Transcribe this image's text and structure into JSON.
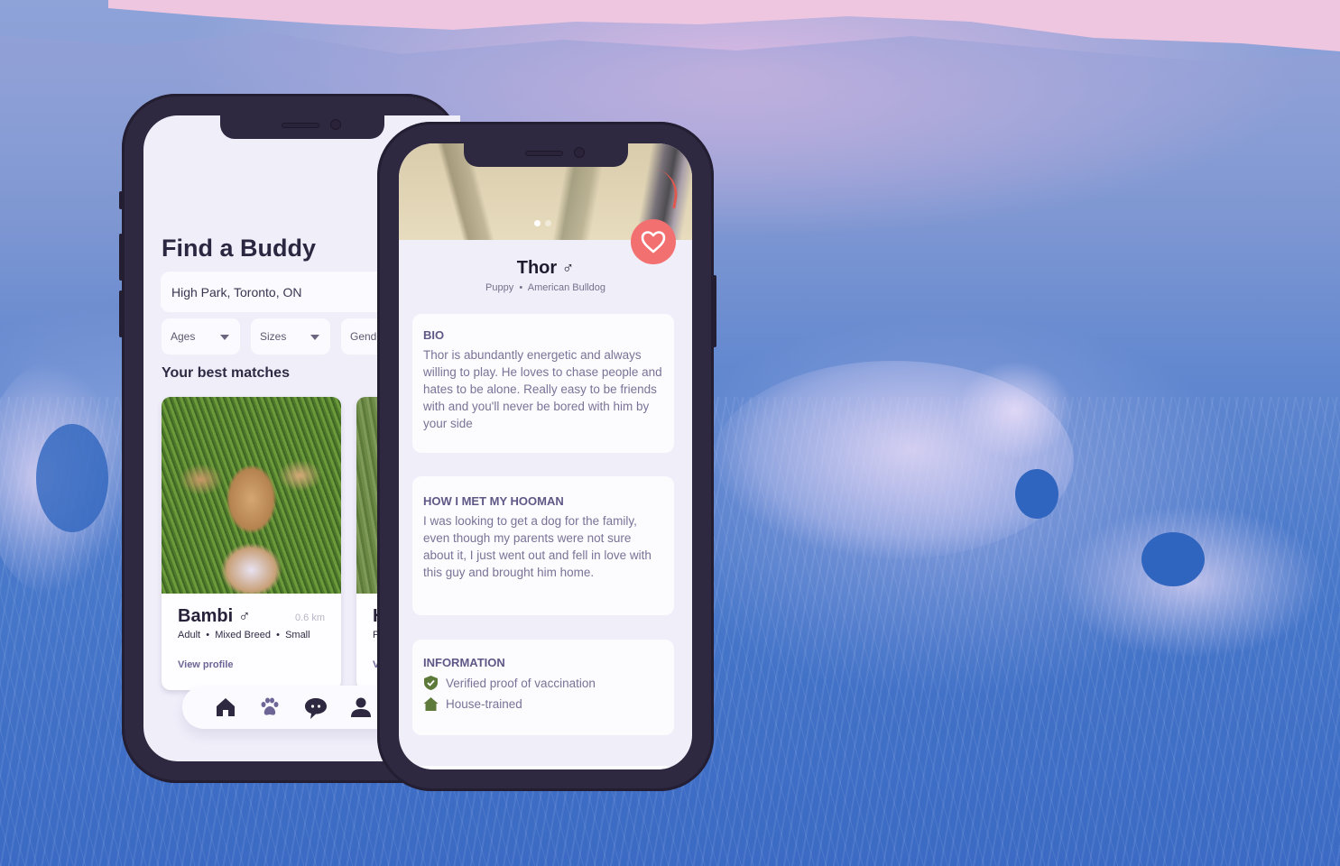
{
  "colors": {
    "phone_frame": "#2f2841",
    "screen_bg": "#f0eef9",
    "card_bg": "#fefdff",
    "accent_purple": "#6c6596",
    "favorite_red": "#f27070",
    "text_dark": "#27223a",
    "info_green": "#5d7a3a"
  },
  "find_buddy_screen": {
    "title": "Find a Buddy",
    "search": {
      "value": "High Park, Toronto, ON",
      "icon": "location-icon"
    },
    "filters": [
      {
        "label": "Ages",
        "icon": "caret-down-icon"
      },
      {
        "label": "Sizes",
        "icon": "caret-down-icon"
      },
      {
        "label": "Gender",
        "icon": "caret-down-icon"
      }
    ],
    "matches_heading": "Your best matches",
    "cards": [
      {
        "name": "Bambi",
        "gender_symbol": "♂",
        "distance": "0.6 km",
        "meta": [
          "Adult",
          "Mixed Breed",
          "Small"
        ],
        "separator": "•",
        "link": "View profile"
      },
      {
        "name": "H",
        "gender_symbol": "",
        "distance": "",
        "meta": [
          "P"
        ],
        "separator": "",
        "link": "V"
      }
    ],
    "bottom_nav": [
      {
        "name": "home",
        "icon": "home-icon",
        "active": false
      },
      {
        "name": "pets",
        "icon": "paw-icon",
        "active": true
      },
      {
        "name": "messages",
        "icon": "chat-icon",
        "active": false
      },
      {
        "name": "profile",
        "icon": "user-icon",
        "active": false
      }
    ]
  },
  "profile_screen": {
    "photo_count": 2,
    "active_photo": 1,
    "favorite_icon": "heart-icon",
    "name": "Thor",
    "gender_symbol": "♂",
    "age": "Puppy",
    "separator": "•",
    "breed": "American Bulldog",
    "bio": {
      "title": "BIO",
      "text": "Thor is abundantly energetic and always willing to play. He loves to chase people and hates to be alone. Really easy to be friends with and you'll never be bored with him by your side"
    },
    "story": {
      "title": "HOW I MET MY HOOMAN",
      "text": "I was looking to get a dog for the family, even though my parents were not sure about it, I just went out and fell in love with this guy and brought him home."
    },
    "information": {
      "title": "INFORMATION",
      "items": [
        {
          "icon": "shield-check-icon",
          "label": "Verified proof of vaccination"
        },
        {
          "icon": "house-icon",
          "label": "House-trained"
        }
      ]
    }
  }
}
